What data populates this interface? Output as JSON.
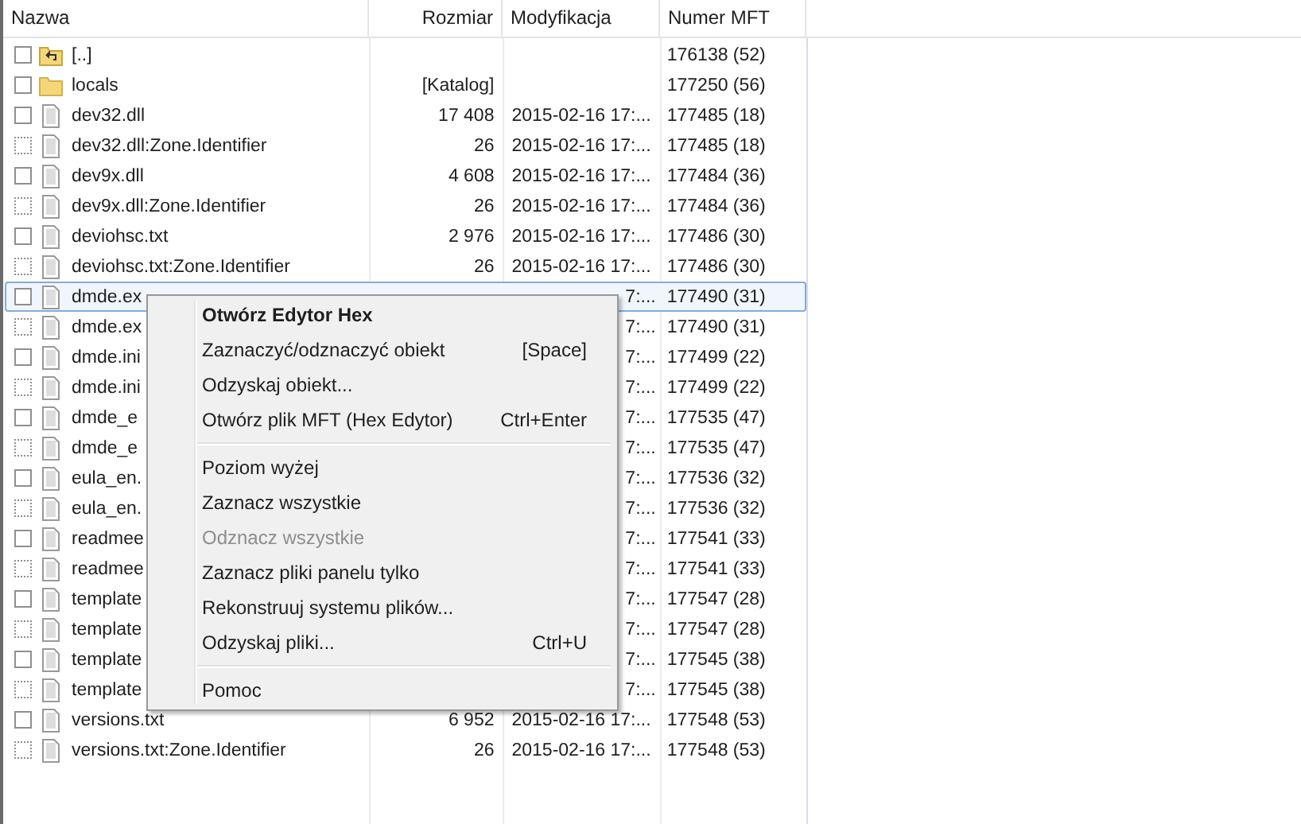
{
  "table": {
    "columns": [
      "Nazwa",
      "Rozmiar",
      "Modyfikacja",
      "Numer MFT"
    ],
    "rows": [
      {
        "kind": "parent",
        "checked": false,
        "selected": false,
        "name": "[..]",
        "mft": "176138 (52)"
      },
      {
        "kind": "folder",
        "checked": false,
        "selected": false,
        "name": "locals",
        "size": "[Katalog]",
        "mft": "177250 (56)"
      },
      {
        "kind": "file",
        "checked": false,
        "selected": false,
        "name": "dev32.dll",
        "size": "17 408",
        "modified": "2015-02-16 17:...",
        "mft": "177485 (18)"
      },
      {
        "kind": "stream",
        "checked": false,
        "selected": false,
        "name": "dev32.dll:Zone.Identifier",
        "size": "26",
        "modified": "2015-02-16 17:...",
        "mft": "177485 (18)"
      },
      {
        "kind": "file",
        "checked": false,
        "selected": false,
        "name": "dev9x.dll",
        "size": "4 608",
        "modified": "2015-02-16 17:...",
        "mft": "177484 (36)"
      },
      {
        "kind": "stream",
        "checked": false,
        "selected": false,
        "name": "dev9x.dll:Zone.Identifier",
        "size": "26",
        "modified": "2015-02-16 17:...",
        "mft": "177484 (36)"
      },
      {
        "kind": "file",
        "checked": false,
        "selected": false,
        "name": "deviohsc.txt",
        "size": "2 976",
        "modified": "2015-02-16 17:...",
        "mft": "177486 (30)"
      },
      {
        "kind": "stream",
        "checked": false,
        "selected": false,
        "name": "deviohsc.txt:Zone.Identifier",
        "size": "26",
        "modified": "2015-02-16 17:...",
        "mft": "177486 (30)"
      },
      {
        "kind": "file",
        "checked": false,
        "selected": true,
        "name": "dmde.ex",
        "modified_tail": "7:...",
        "mft": "177490 (31)"
      },
      {
        "kind": "stream",
        "checked": false,
        "selected": false,
        "name": "dmde.ex",
        "modified_tail": "7:...",
        "mft": "177490 (31)"
      },
      {
        "kind": "file",
        "checked": false,
        "selected": false,
        "name": "dmde.ini",
        "modified_tail": "7:...",
        "mft": "177499 (22)"
      },
      {
        "kind": "stream",
        "checked": false,
        "selected": false,
        "name": "dmde.ini",
        "modified_tail": "7:...",
        "mft": "177499 (22)"
      },
      {
        "kind": "file",
        "checked": false,
        "selected": false,
        "name": "dmde_e",
        "modified_tail": "7:...",
        "mft": "177535 (47)"
      },
      {
        "kind": "stream",
        "checked": false,
        "selected": false,
        "name": "dmde_e",
        "modified_tail": "7:...",
        "mft": "177535 (47)"
      },
      {
        "kind": "file",
        "checked": false,
        "selected": false,
        "name": "eula_en.",
        "modified_tail": "7:...",
        "mft": "177536 (32)"
      },
      {
        "kind": "stream",
        "checked": false,
        "selected": false,
        "name": "eula_en.",
        "modified_tail": "7:...",
        "mft": "177536 (32)"
      },
      {
        "kind": "file",
        "checked": false,
        "selected": false,
        "name": "readmee",
        "modified_tail": "7:...",
        "mft": "177541 (33)"
      },
      {
        "kind": "stream",
        "checked": false,
        "selected": false,
        "name": "readmee",
        "modified_tail": "7:...",
        "mft": "177541 (33)"
      },
      {
        "kind": "file",
        "checked": false,
        "selected": false,
        "name": "template",
        "modified_tail": "7:...",
        "mft": "177547 (28)"
      },
      {
        "kind": "stream",
        "checked": false,
        "selected": false,
        "name": "template",
        "modified_tail": "7:...",
        "mft": "177547 (28)"
      },
      {
        "kind": "file",
        "checked": false,
        "selected": false,
        "name": "template",
        "modified_tail": "7:...",
        "mft": "177545 (38)"
      },
      {
        "kind": "stream",
        "checked": false,
        "selected": false,
        "name": "template",
        "modified_tail": "7:...",
        "mft": "177545 (38)"
      },
      {
        "kind": "file",
        "checked": false,
        "selected": false,
        "name": "versions.txt",
        "size": "6 952",
        "modified": "2015-02-16 17:...",
        "mft": "177548 (53)"
      },
      {
        "kind": "stream",
        "checked": false,
        "selected": false,
        "name": "versions.txt:Zone.Identifier",
        "size": "26",
        "modified": "2015-02-16 17:...",
        "mft": "177548 (53)"
      }
    ]
  },
  "context_menu": {
    "items": [
      {
        "kind": "item",
        "label": "Otwórz Edytor Hex",
        "default": true,
        "disabled": false
      },
      {
        "kind": "item",
        "label": "Zaznaczyć/odznaczyć obiekt",
        "shortcut": "[Space]",
        "default": false,
        "disabled": false
      },
      {
        "kind": "item",
        "label": "Odzyskaj obiekt...",
        "default": false,
        "disabled": false
      },
      {
        "kind": "item",
        "label": "Otwórz plik MFT (Hex Edytor)",
        "shortcut": "Ctrl+Enter",
        "default": false,
        "disabled": false
      },
      {
        "kind": "separator"
      },
      {
        "kind": "item",
        "label": "Poziom wyżej",
        "default": false,
        "disabled": false
      },
      {
        "kind": "item",
        "label": "Zaznacz wszystkie",
        "default": false,
        "disabled": false
      },
      {
        "kind": "item",
        "label": "Odznacz wszystkie",
        "default": false,
        "disabled": true
      },
      {
        "kind": "item",
        "label": "Zaznacz pliki panelu tylko",
        "default": false,
        "disabled": false
      },
      {
        "kind": "item",
        "label": "Rekonstruuj systemu plików...",
        "default": false,
        "disabled": false
      },
      {
        "kind": "item",
        "label": "Odzyskaj pliki...",
        "shortcut": "Ctrl+U",
        "default": false,
        "disabled": false
      },
      {
        "kind": "separator"
      },
      {
        "kind": "item",
        "label": "Pomoc",
        "default": false,
        "disabled": false
      }
    ]
  }
}
